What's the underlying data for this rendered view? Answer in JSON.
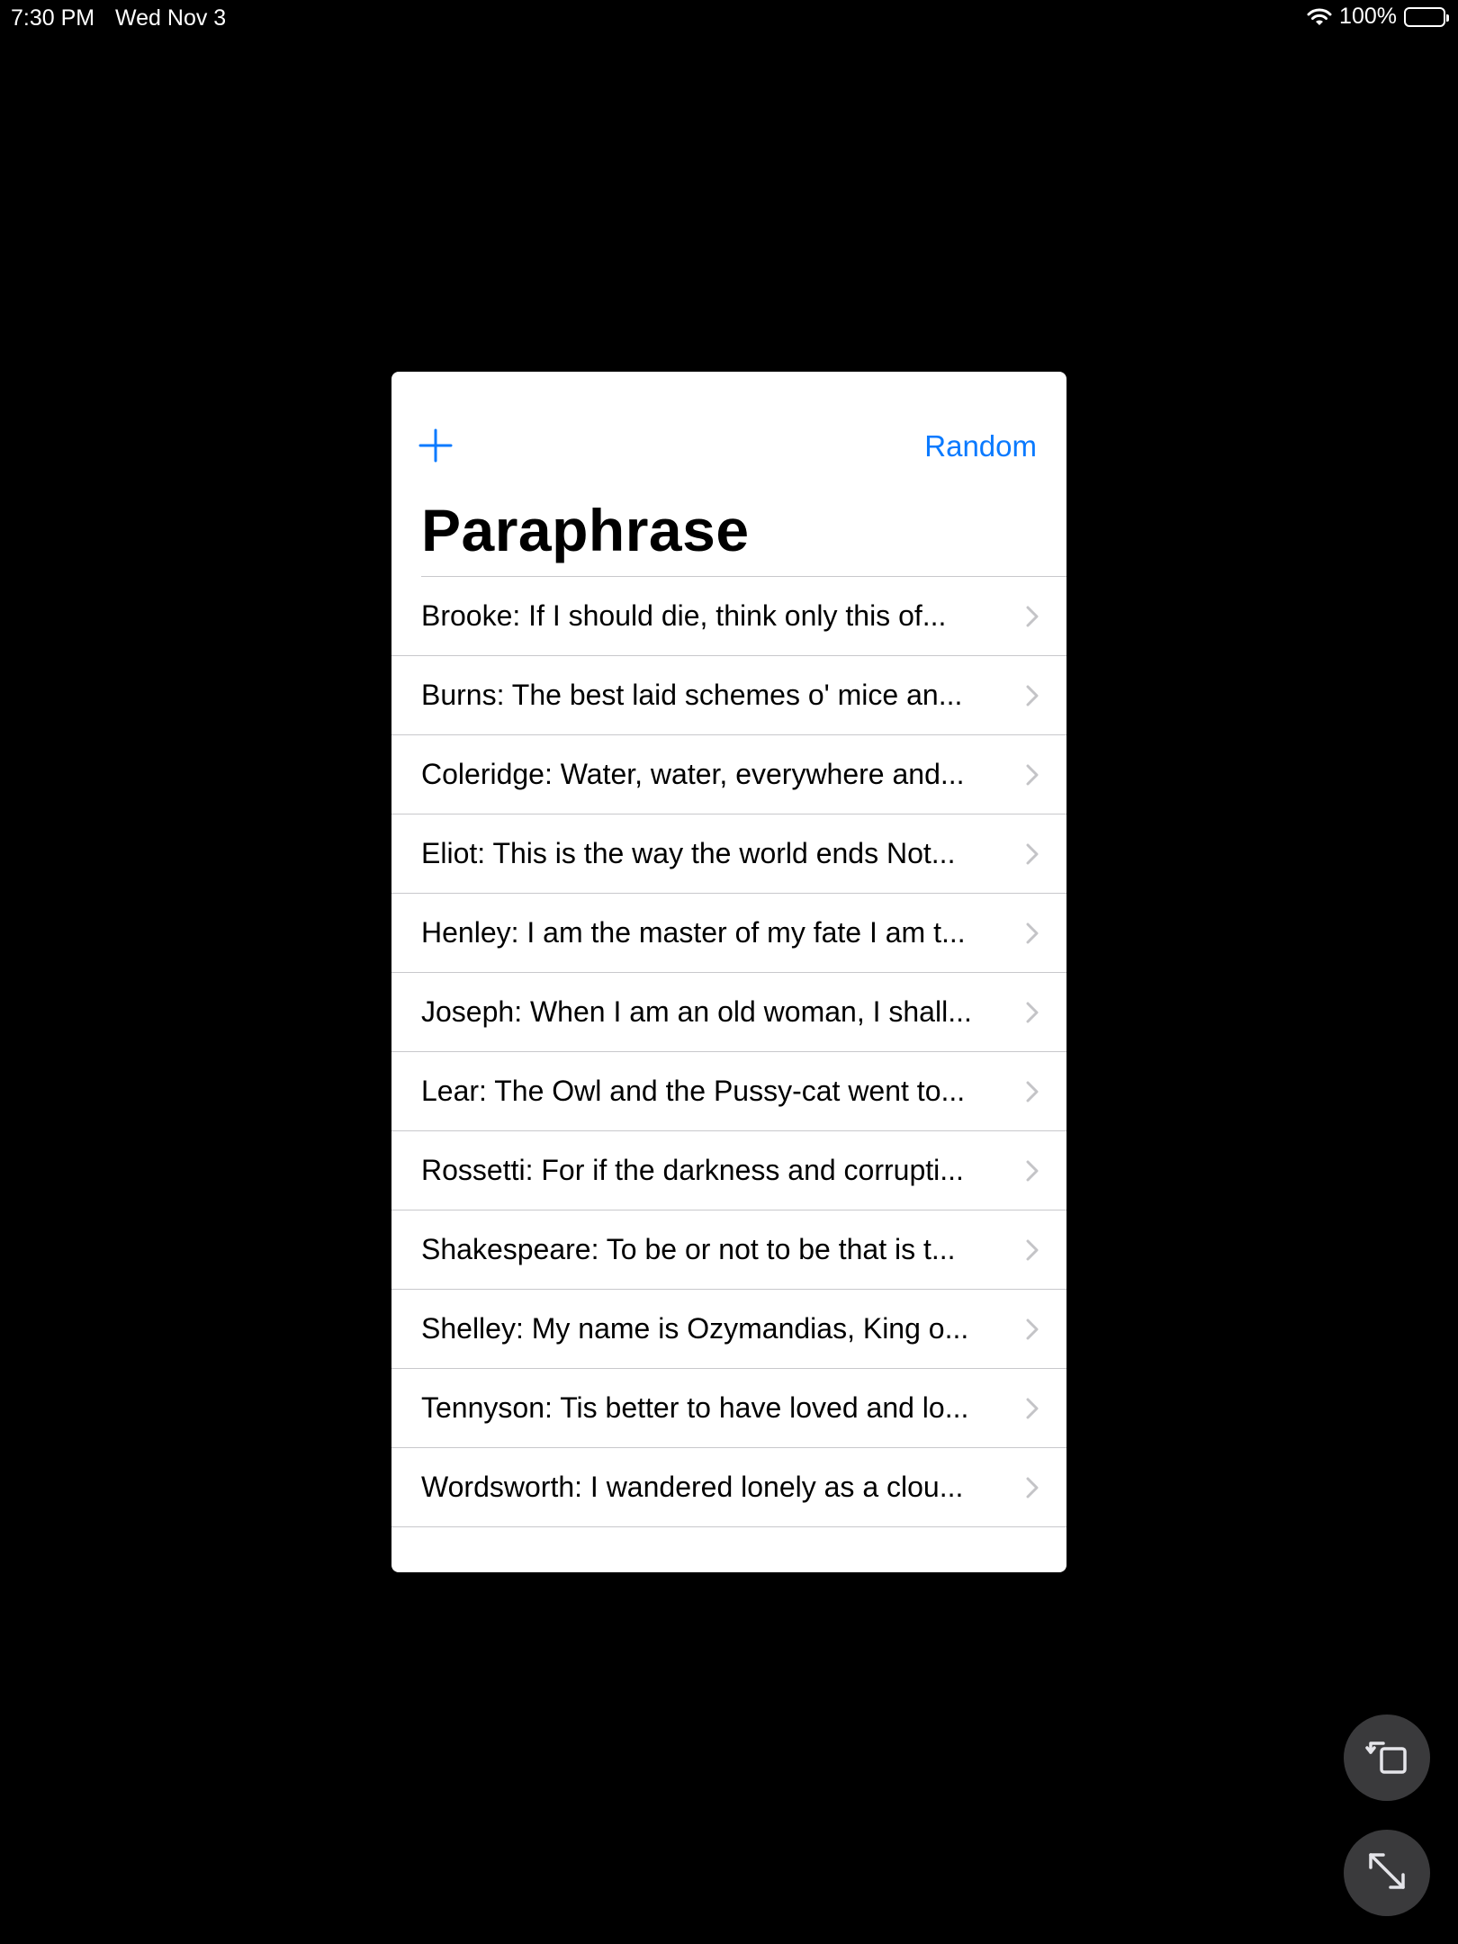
{
  "status_bar": {
    "time": "7:30 PM",
    "date": "Wed Nov 3",
    "battery": "100%"
  },
  "nav": {
    "add_icon": "plus-icon",
    "random_label": "Random",
    "title": "Paraphrase"
  },
  "list": {
    "items": [
      {
        "label": "Brooke: If I should die, think only this of..."
      },
      {
        "label": "Burns: The best laid schemes o' mice an..."
      },
      {
        "label": "Coleridge: Water, water, everywhere and..."
      },
      {
        "label": "Eliot: This is the way the world ends Not..."
      },
      {
        "label": "Henley: I am the master of my fate I am t..."
      },
      {
        "label": "Joseph: When I am an old woman, I shall..."
      },
      {
        "label": "Lear: The Owl and the Pussy-cat went to..."
      },
      {
        "label": "Rossetti: For if the darkness and corrupti..."
      },
      {
        "label": "Shakespeare: To be or not to be that is t..."
      },
      {
        "label": "Shelley: My name is Ozymandias, King o..."
      },
      {
        "label": "Tennyson: Tis better to have loved and lo..."
      },
      {
        "label": "Wordsworth: I wandered lonely as a clou..."
      }
    ]
  },
  "colors": {
    "accent": "#0a7aff",
    "background": "#000000",
    "separator": "#c8c8cc"
  },
  "floating_buttons": {
    "rotate_icon": "rotate-icon",
    "resize_icon": "resize-icon"
  }
}
